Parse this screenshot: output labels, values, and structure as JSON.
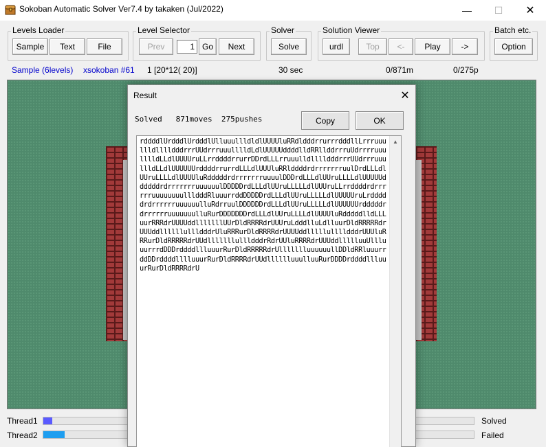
{
  "window": {
    "title": "Sokoban Automatic Solver Ver7.4 by takaken (Jul/2022)",
    "icons": {
      "app": "treasure-chest-icon",
      "minimize": "minimize-icon",
      "maximize": "maximize-icon",
      "close": "close-icon"
    },
    "minimize_glyph": "—",
    "maximize_glyph": "☐",
    "close_glyph": "✕"
  },
  "toolbar": {
    "levels_loader": {
      "label": "Levels Loader",
      "sample": "Sample",
      "text": "Text",
      "file": "File"
    },
    "level_selector": {
      "label": "Level Selector",
      "prev": "Prev",
      "level_number": "1",
      "go": "Go",
      "next": "Next"
    },
    "solver": {
      "label": "Solver",
      "solve": "Solve"
    },
    "solution_viewer": {
      "label": "Solution Viewer",
      "urdl": "urdl",
      "top": "Top",
      "back": "<-",
      "play": "Play",
      "forward": "->"
    },
    "batch": {
      "label": "Batch etc.",
      "option": "Option"
    }
  },
  "status": {
    "collection": "Sample (6levels)",
    "level_name": "xsokoban #61",
    "level_info": "1 [20*12( 20)]",
    "time": "30 sec",
    "moves": "0/871m",
    "pushes": "0/275p"
  },
  "threads": [
    {
      "label": "Thread1",
      "state": "Solved",
      "progress": 0.02,
      "color": "#5a5aff"
    },
    {
      "label": "Thread2",
      "state": "Failed",
      "progress": 0.05,
      "color": "#1e9ef0"
    }
  ],
  "dialog": {
    "title": "Result",
    "close_glyph": "✕",
    "summary": "Solved   871moves  275pushes",
    "copy": "Copy",
    "ok": "OK",
    "solution": "rddddlUrdddlUrdddlUlluuullldldlUUUUluRRdldddrrurrrdddllLrrruuullldlllldddrrrUUdrrruuulllldLdlUUUUUddddlldRRllddrrruUdrrrruuulllldLLdlUUUUruLLrrddddrrurrDDrdLLLrruuulldlllldddrrrUUdrrruuullldLLdlUUUUUUrddddrrurrdLLLdlUUUluRRlddddrdrrrrrrruulDrdLLLdlUUruLLLLdlUUUUluRdddddrdrrrrrrruuuulDDDrdLLLdlUUruLLLLdlUUUUUddddddrdrrrrrrruuuuuulDDDDDrdLLLdlUUruLLLLLdlUUUruLLrrddddrdrrrrrruuuuuuuullldddRluuurrddDDDDDrdLLLdlUUruLLLLLdlUUUUUruLrdddddrdrrrrrruuuuuulluRdrruulDDDDDDrdLLLdlUUruLLLLLdlUUUUUUrdddddrdrrrrrruuuuuuulluRurDDDDDDDrdLLLdlUUruLLLLdlUUUUluRdddddlldLLLuurRRRdrUUUUddlllllllUUrDldRRRRdrUUUruLdddlluLdlluurDldRRRRRdrUUUddllllllullldddrUluRRRurDldRRRRdrUUUUddlllllulllldddrUUUluRRRurDldRRRRRdrUUdlllllllullldddrRdrUUluRRRRdrUUUddllllluuUllluuurrrdDDDrddddllluuurRurDldRRRRRdrUllllllluuuuuullDDldRRluuurrddDDrddddlllluuurRurDldRRRRdrUUdlllllluuulluuRurDDDDrddddllluuurRurDldRRRRdrU"
  }
}
